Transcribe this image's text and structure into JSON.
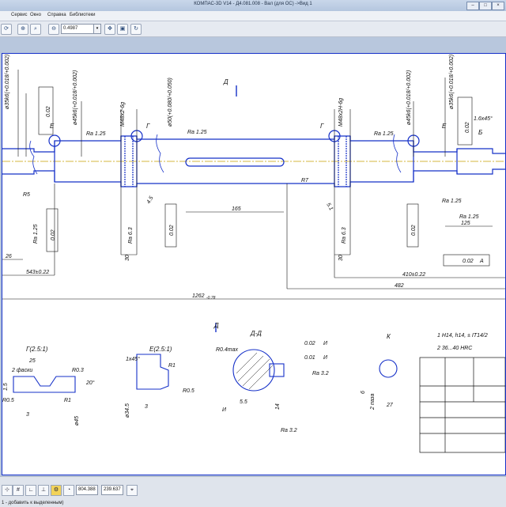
{
  "window": {
    "title": "КОМПАС-3D V14 - Д4.081.008 - Вал (для ОС) ->Вид 1"
  },
  "menu": [
    "Сервис",
    "Окно",
    "Справка",
    "Библиотеки"
  ],
  "toolbar": {
    "zoom_value": "0.4987",
    "zoom_dropdown": "▾"
  },
  "status": {
    "coord_x": "804.388",
    "coord_y": "239.637",
    "hint": "1 - добавить к выделенным)"
  },
  "drawing": {
    "section_marks": {
      "d": "Д",
      "e": "Е",
      "g": "Г",
      "b": "Б",
      "k": "К"
    },
    "dims_top": [
      "ø35k6(+0.018/+0.002)",
      "ø45k6(+0.018/+0.002)",
      "M48x2-6g",
      "ø50(+0.080/+0.050)",
      "M48x2H-6g",
      "ø45k6(+0.018/+0.002)",
      "ø35k6(+0.018/+0.002)",
      "1.6x45°"
    ],
    "tolerance_boxes": [
      "0.02",
      "A",
      "0.02",
      "A",
      "0.02",
      "A"
    ],
    "roughness": [
      "Ra 1.25",
      "Ra 1.25",
      "Ra 1.25",
      "Ra 1.25",
      "Ra 1.25",
      "Ra 6.3",
      "Ra 6.3",
      "Ra 1.25",
      "Ra 1.25"
    ],
    "linear_dims": [
      "R5",
      "R7",
      "4.5",
      "5.1",
      "30",
      "30",
      "165",
      "125",
      "26",
      "543±0.22",
      "410±0.22",
      "482",
      "1262"
    ],
    "tol_1262": "-0.78",
    "detail_g_title": "Г(2.5:1)",
    "detail_g": [
      "25",
      "2 фаски",
      "R0.3",
      "R0.5",
      "R1",
      "20°",
      "ø45",
      "3",
      "1.5"
    ],
    "detail_e_title": "Е(2.5:1)",
    "detail_e": [
      "1x45°",
      "R1",
      "R0.5",
      "ø34.5",
      "3"
    ],
    "section_dd_title": "Д-Д",
    "section_dd": [
      "R0.4max",
      "0.02",
      "И",
      "0.01",
      "И",
      "Ra 3.2",
      "5.5",
      "14",
      "Ra 3.2",
      "И"
    ],
    "section_k": [
      "6",
      "2 паза",
      "27"
    ],
    "notes": [
      "1 H14, h14, ± IT14/2",
      "2 36...40 HRC"
    ]
  },
  "colors": {
    "sheet_border": "#1530c8",
    "geometry": "#1530c8",
    "dims": "#111111",
    "axis": "#c8a000"
  }
}
